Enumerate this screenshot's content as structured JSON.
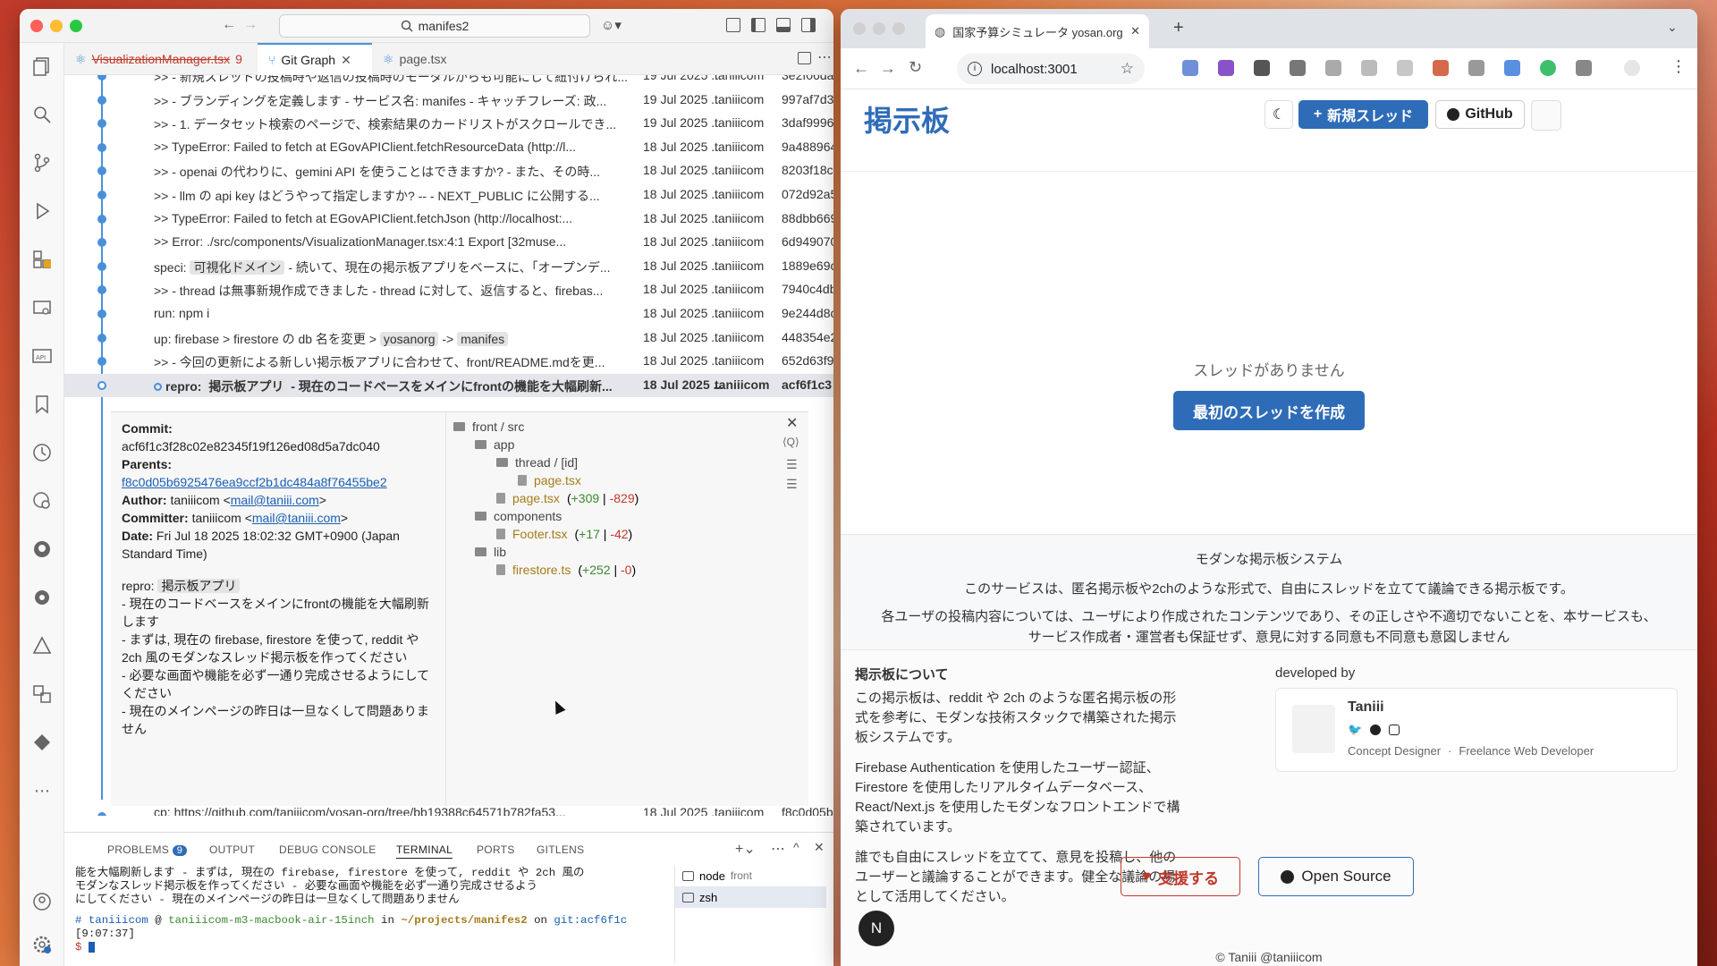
{
  "vscode": {
    "command_center": "manifes2",
    "tabs": [
      {
        "label": "VisualizationManager.tsx",
        "badge": "9"
      },
      {
        "label": "Git Graph"
      },
      {
        "label": "page.tsx"
      }
    ],
    "commits": [
      {
        "msg": ">> - 新規スレッドの投稿時や返信の投稿時のモーダルからも可能にして紐付けられ...",
        "date": "19 Jul 2025 ...",
        "author": "taniiicom",
        "hash": "3e2f06da"
      },
      {
        "msg": ">> - ブランディングを定義します - サービス名: manifes - キャッチフレーズ: 政...",
        "date": "19 Jul 2025 ...",
        "author": "taniiicom",
        "hash": "997af7d3"
      },
      {
        "msg": ">> - 1. データセット検索のページで、検索結果のカードリストがスクロールでき...",
        "date": "19 Jul 2025 ...",
        "author": "taniiicom",
        "hash": "3daf9996"
      },
      {
        "msg": ">> TypeError: Failed to fetch at EGovAPIClient.fetchResourceData (http://l...",
        "date": "18 Jul 2025 ...",
        "author": "taniiicom",
        "hash": "9a488964"
      },
      {
        "msg": ">> - openai の代わりに、gemini API を使うことはできますか? - また、その時...",
        "date": "18 Jul 2025 ...",
        "author": "taniiicom",
        "hash": "8203f18c"
      },
      {
        "msg": ">> - llm の api key はどうやって指定しますか? -- - NEXT_PUBLIC に公開する...",
        "date": "18 Jul 2025 ...",
        "author": "taniiicom",
        "hash": "072d92a5"
      },
      {
        "msg": ">> TypeError: Failed to fetch at EGovAPIClient.fetchJson (http://localhost:...",
        "date": "18 Jul 2025 ...",
        "author": "taniiicom",
        "hash": "88dbb669"
      },
      {
        "msg": ">> Error: ./src/components/VisualizationManager.tsx:4:1 Export [32muse...",
        "date": "18 Jul 2025 ...",
        "author": "taniiicom",
        "hash": "6d949070"
      },
      {
        "pre": "speci: ",
        "tag": "可視化ドメイン",
        "post": " - 続いて、現在の掲示板アプリをベースに、「オープンデ...",
        "date": "18 Jul 2025 ...",
        "author": "taniiicom",
        "hash": "1889e69c"
      },
      {
        "msg": ">> - thread は無事新規作成できました - thread に対して、返信すると、firebas...",
        "date": "18 Jul 2025 ...",
        "author": "taniiicom",
        "hash": "7940c4db"
      },
      {
        "msg": "run: npm i",
        "date": "18 Jul 2025 ...",
        "author": "taniiicom",
        "hash": "9e244d8c"
      },
      {
        "pre": "up: firebase > firestore の db 名を変更 > ",
        "tag": "yosanorg",
        "mid": " -> ",
        "tag2": "manifes",
        "date": "18 Jul 2025 ...",
        "author": "taniiicom",
        "hash": "448354e2"
      },
      {
        "msg": ">> - 今回の更新による新しい掲示板アプリに合わせて、front/README.mdを更...",
        "date": "18 Jul 2025 ...",
        "author": "taniiicom",
        "hash": "652d63f9"
      },
      {
        "pre": "repro: ",
        "tag": "掲示板アプリ",
        "post": " - 現在のコードベースをメインにfrontの機能を大幅刷新...",
        "date": "18 Jul 2025 ...",
        "author": "taniiicom",
        "hash": "acf6f1c3",
        "selected": true
      }
    ],
    "last_commit": {
      "msg": "cp: https://github.com/taniiicom/yosan-org/tree/bb19388c64571b782fa53...",
      "date": "18 Jul 2025 ...",
      "author": "taniiicom",
      "hash": "f8c0d05b"
    },
    "detail": {
      "commit_label": "Commit:",
      "commit_hash": "acf6f1c3f28c02e82345f19f126ed08d5a7dc040",
      "parents_label": "Parents:",
      "parent_hash": "f8c0d05b6925476ea9ccf2b1dc484a8f76455be2",
      "author_label": "Author:",
      "author_name": "taniiicom <",
      "author_email": "mail@taniii.com",
      "author_end": ">",
      "committer_label": "Committer:",
      "committer_name": "taniiicom <",
      "committer_email": "mail@taniii.com",
      "committer_end": ">",
      "date_label": "Date:",
      "date_value": "Fri Jul 18 2025 18:02:32 GMT+0900 (Japan Standard Time)",
      "body_prefix": "repro: ",
      "body_tag": "掲示板アプリ",
      "body_lines": [
        "- 現在のコードベースをメインにfrontの機能を大幅刷新します",
        "- まずは, 現在の firebase, firestore を使って, reddit や 2ch 風のモダンなスレッド掲示板を作ってください",
        "- 必要な画面や機能を必ず一通り完成させるようにしてください",
        "- 現在のメインページの昨日は一旦なくして問題ありません"
      ]
    },
    "tree": {
      "root": "front / src",
      "app": "app",
      "thread": "thread / [id]",
      "thread_page": "page.tsx",
      "app_page": "page.tsx",
      "app_page_add": "+309",
      "app_page_del": "-829",
      "components": "components",
      "footer": "Footer.tsx",
      "footer_add": "+17",
      "footer_del": "-42",
      "lib": "lib",
      "firestore": "firestore.ts",
      "firestore_add": "+252",
      "firestore_del": "-0"
    },
    "panel": {
      "tabs": [
        "PROBLEMS",
        "OUTPUT",
        "DEBUG CONSOLE",
        "TERMINAL",
        "PORTS",
        "GITLENS"
      ],
      "problems_count": "9",
      "active_tab": "TERMINAL",
      "terminal_lines": [
        "能を大幅刷新します - まずは, 現在の firebase, firestore を使って, reddit や 2ch 風の",
        "モダンなスレッド掲示板を作ってください - 必要な画面や機能を必ず一通り完成させるよう",
        "にしてください - 現在のメインページの昨日は一旦なくして問題ありません"
      ],
      "prompt_user": "taniiicom",
      "prompt_at": " @ ",
      "prompt_host": "taniiicom-m3-macbook-air-15inch",
      "prompt_in": " in ",
      "prompt_path": "~/projects/manifes2",
      "prompt_on": " on ",
      "prompt_branch": "git:acf6f1c",
      "prompt_time": "[9:07:37]",
      "prompt_symbol": "$",
      "terminals": [
        {
          "name": "node",
          "detail": "front"
        },
        {
          "name": "zsh",
          "detail": ""
        }
      ]
    }
  },
  "browser": {
    "tab_title": "国家予算シミュレータ yosan.org",
    "url": "localhost:3001",
    "site": {
      "logo": "掲示板",
      "new_thread_label": "新規スレッド",
      "github_label": "GitHub",
      "empty_message": "スレッドがありません",
      "create_first_label": "最初のスレッドを作成",
      "about_title": "モダンな掲示板システム",
      "about_line1": "このサービスは、匿名掲示板や2chのような形式で、自由にスレッドを立てて議論できる掲示板です。",
      "about_line2": "各ユーザの投稿内容については、ユーザにより作成されたコンテンツであり、その正しさや不適切でないことを、本サービスも、",
      "about_line3": "サービス作成者・運営者も保証せず、意見に対する同意も不同意も意図しません",
      "board_title": "掲示板について",
      "board_p1": "この掲示板は、reddit や 2ch のような匿名掲示板の形式を参考に、モダンな技術スタックで構築された掲示板システムです。",
      "board_p2": "Firebase Authentication を使用したユーザー認証、Firestore を使用したリアルタイムデータベース、React/Next.js を使用したモダンなフロントエンドで構築されています。",
      "board_p3": "誰でも自由にスレッドを立てて、意見を投稿し、他のユーザーと議論することができます。健全な議論の場として活用してください。",
      "dev_title": "developed by",
      "dev_name": "Taniii",
      "dev_role1": "Concept Designer",
      "dev_sep": "·",
      "dev_role2": "Freelance Web Developer",
      "support_label": "支援する",
      "opensource_label": "Open Source",
      "copyright": "© Taniii @taniiicom",
      "avatar_letter": "N"
    }
  },
  "colors": {
    "accent": "#2f6cb8",
    "graph_line": "#4a90d9",
    "added": "#3a8a2e",
    "deleted": "#c0392b",
    "support": "#c0392b",
    "folder_tan": "#a67c1a"
  }
}
